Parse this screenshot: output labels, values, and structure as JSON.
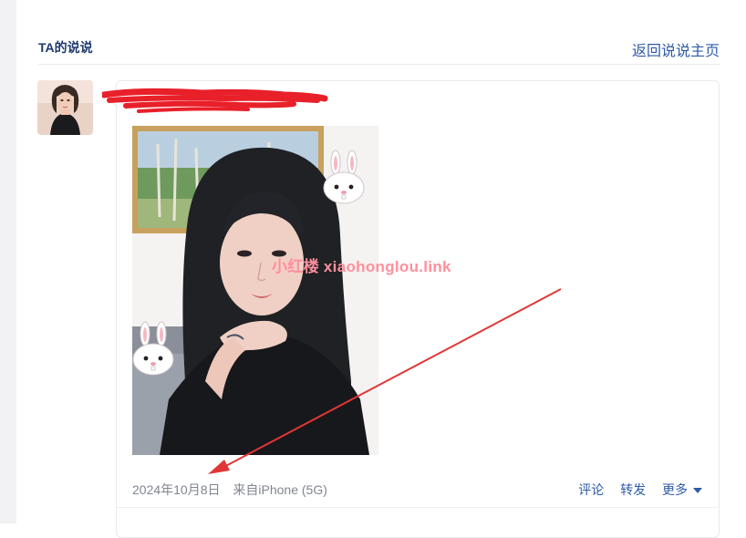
{
  "header": {
    "title": "TA的说说",
    "back_link": "返回说说主页"
  },
  "post": {
    "watermark": "小红楼  xiaohonglou.link",
    "date": "2024年10月8日",
    "source": "来自iPhone (5G)",
    "actions": {
      "comment": "评论",
      "forward": "转发",
      "more": "更多"
    }
  },
  "colors": {
    "title": "#1f3a70",
    "link": "#2e5aa8",
    "meta": "#808690",
    "redaction": "#e8202a",
    "arrow": "#e23636",
    "watermark": "#ff8f9c"
  }
}
